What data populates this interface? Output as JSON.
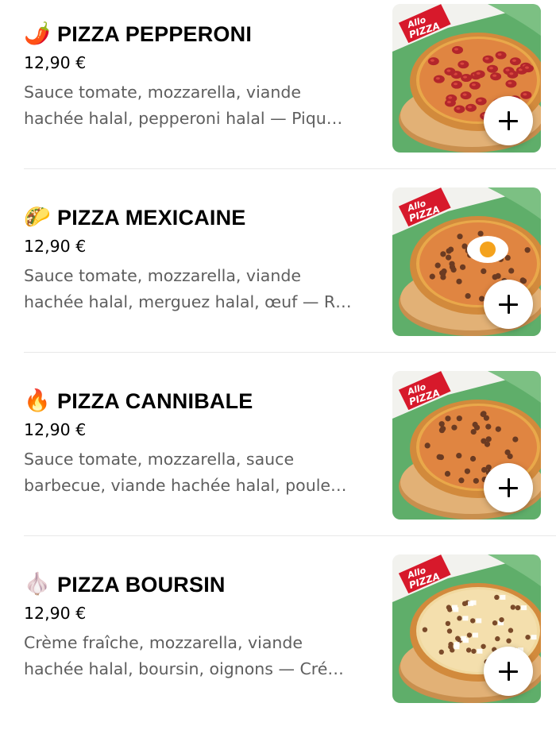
{
  "menu": {
    "items": [
      {
        "emoji": "🌶️",
        "emoji_icon": "chili-pepper-icon",
        "name": "PIZZA PEPPERONI",
        "price": "12,90 €",
        "description_lines": [
          "Sauce tomate, mozzarella, viande",
          "hachée halal, pepperoni halal — Piqu…"
        ],
        "image_brand": "Allo PIZZA"
      },
      {
        "emoji": "🌮",
        "emoji_icon": "taco-icon",
        "name": "PIZZA MEXICAINE",
        "price": "12,90 €",
        "description_lines": [
          "Sauce tomate, mozzarella, viande",
          "hachée halal, merguez halal, œuf — R…"
        ],
        "image_brand": "Allo PIZZA"
      },
      {
        "emoji": "🔥",
        "emoji_icon": "fire-icon",
        "name": "PIZZA CANNIBALE",
        "price": "12,90 €",
        "description_lines": [
          "Sauce tomate, mozzarella, sauce",
          "barbecue, viande hachée halal, poule…"
        ],
        "image_brand": "Allo PIZZA"
      },
      {
        "emoji": "🧄",
        "emoji_icon": "garlic-icon",
        "name": "PIZZA BOURSIN",
        "price": "12,90 €",
        "description_lines": [
          "Crème fraîche, mozzarella, viande",
          "hachée halal, boursin, oignons — Cré…"
        ],
        "image_brand": "Allo PIZZA"
      }
    ]
  },
  "colors": {
    "title": "#000000",
    "price": "#000000",
    "description": "#5e5e5e",
    "divider": "#e8e8e8",
    "thumb_green": "#5fae6a",
    "brand_red": "#d7192b"
  }
}
